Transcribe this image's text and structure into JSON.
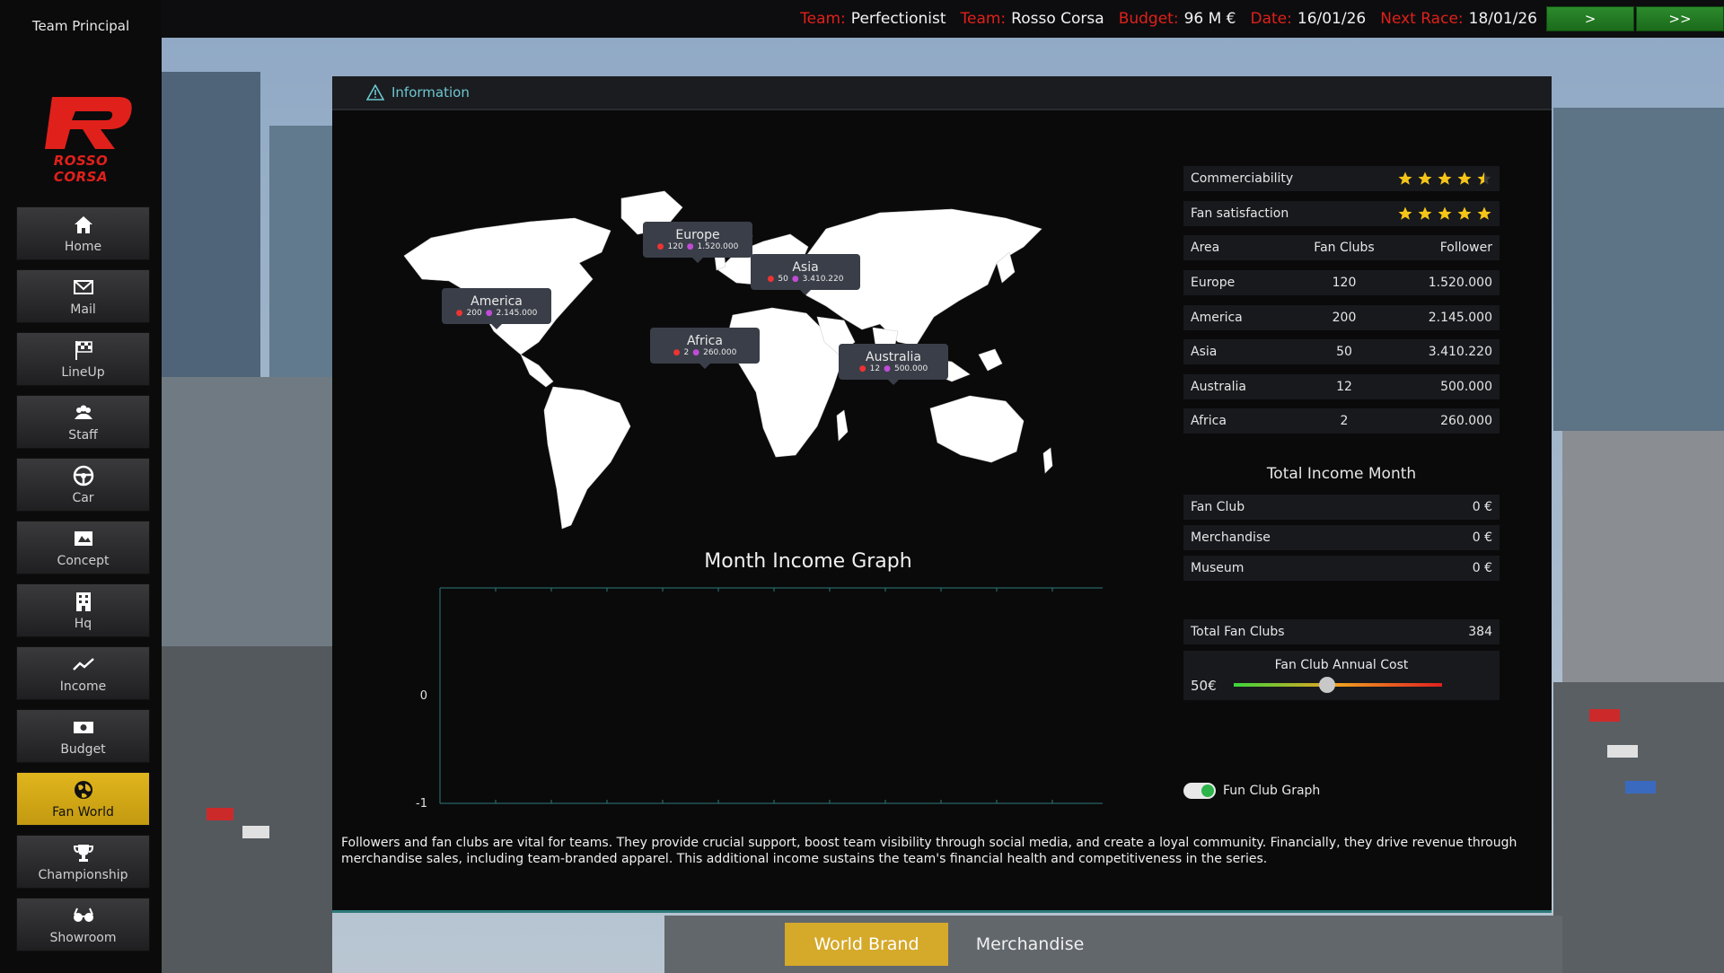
{
  "topbar": {
    "team_label": "Team:",
    "team_value": "Perfectionist",
    "team2_label": "Team:",
    "team2_value": "Rosso Corsa",
    "budget_label": "Budget:",
    "budget_value": "96 M €",
    "date_label": "Date:",
    "date_value": "16/01/26",
    "next_label": "Next Race:",
    "next_value": "18/01/26",
    "btn_next": ">",
    "btn_skip": ">>"
  },
  "sidebar": {
    "role": "Team Principal",
    "brand": "ROSSO CORSA",
    "items": [
      {
        "label": "Home",
        "icon": "home-icon"
      },
      {
        "label": "Mail",
        "icon": "mail-icon"
      },
      {
        "label": "LineUp",
        "icon": "flag-icon"
      },
      {
        "label": "Staff",
        "icon": "staff-icon"
      },
      {
        "label": "Car",
        "icon": "steering-wheel-icon"
      },
      {
        "label": "Concept",
        "icon": "concept-icon"
      },
      {
        "label": "Hq",
        "icon": "building-icon"
      },
      {
        "label": "Income",
        "icon": "trend-icon"
      },
      {
        "label": "Budget",
        "icon": "money-icon"
      },
      {
        "label": "Fan World",
        "icon": "globe-icon"
      },
      {
        "label": "Championship",
        "icon": "trophy-icon"
      },
      {
        "label": "Showroom",
        "icon": "glasses-icon"
      }
    ],
    "active_index": 9
  },
  "panel": {
    "header": "Information",
    "pins": [
      {
        "name": "Europe",
        "clubs": "120",
        "followers": "1.520.000"
      },
      {
        "name": "Asia",
        "clubs": "50",
        "followers": "3.410.220"
      },
      {
        "name": "America",
        "clubs": "200",
        "followers": "2.145.000"
      },
      {
        "name": "Africa",
        "clubs": "2",
        "followers": "260.000"
      },
      {
        "name": "Australia",
        "clubs": "12",
        "followers": "500.000"
      }
    ],
    "graph_title": "Month Income Graph",
    "graph_y_labels": [
      "0",
      "-1"
    ],
    "description": "Followers and fan clubs are vital for teams. They provide crucial support, boost team visibility through social media, and create a loyal community. Financially, they drive revenue through merchandise sales, including team-branded apparel. This additional income sustains the team's financial health and competitiveness in the series."
  },
  "ratings": {
    "commerciability_label": "Commerciability",
    "commerciability_stars": 4.5,
    "fan_satisfaction_label": "Fan satisfaction",
    "fan_satisfaction_stars": 5
  },
  "area_table": {
    "headers": [
      "Area",
      "Fan Clubs",
      "Follower"
    ],
    "rows": [
      [
        "Europe",
        "120",
        "1.520.000"
      ],
      [
        "America",
        "200",
        "2.145.000"
      ],
      [
        "Asia",
        "50",
        "3.410.220"
      ],
      [
        "Australia",
        "12",
        "500.000"
      ],
      [
        "Africa",
        "2",
        "260.000"
      ]
    ]
  },
  "income": {
    "title": "Total Income Month",
    "rows": [
      [
        "Fan Club",
        "0 €"
      ],
      [
        "Merchandise",
        "0 €"
      ],
      [
        "Museum",
        "0 €"
      ]
    ]
  },
  "fanclubs": {
    "total_label": "Total Fan Clubs",
    "total_value": "384",
    "cost_label": "Fan Club Annual Cost",
    "cost_value": "50€",
    "cost_slider_fraction": 0.45,
    "graph_toggle_label": "Fun Club Graph",
    "graph_toggle_on": true
  },
  "tabs": {
    "world_brand": "World Brand",
    "merchandise": "Merchandise"
  }
}
